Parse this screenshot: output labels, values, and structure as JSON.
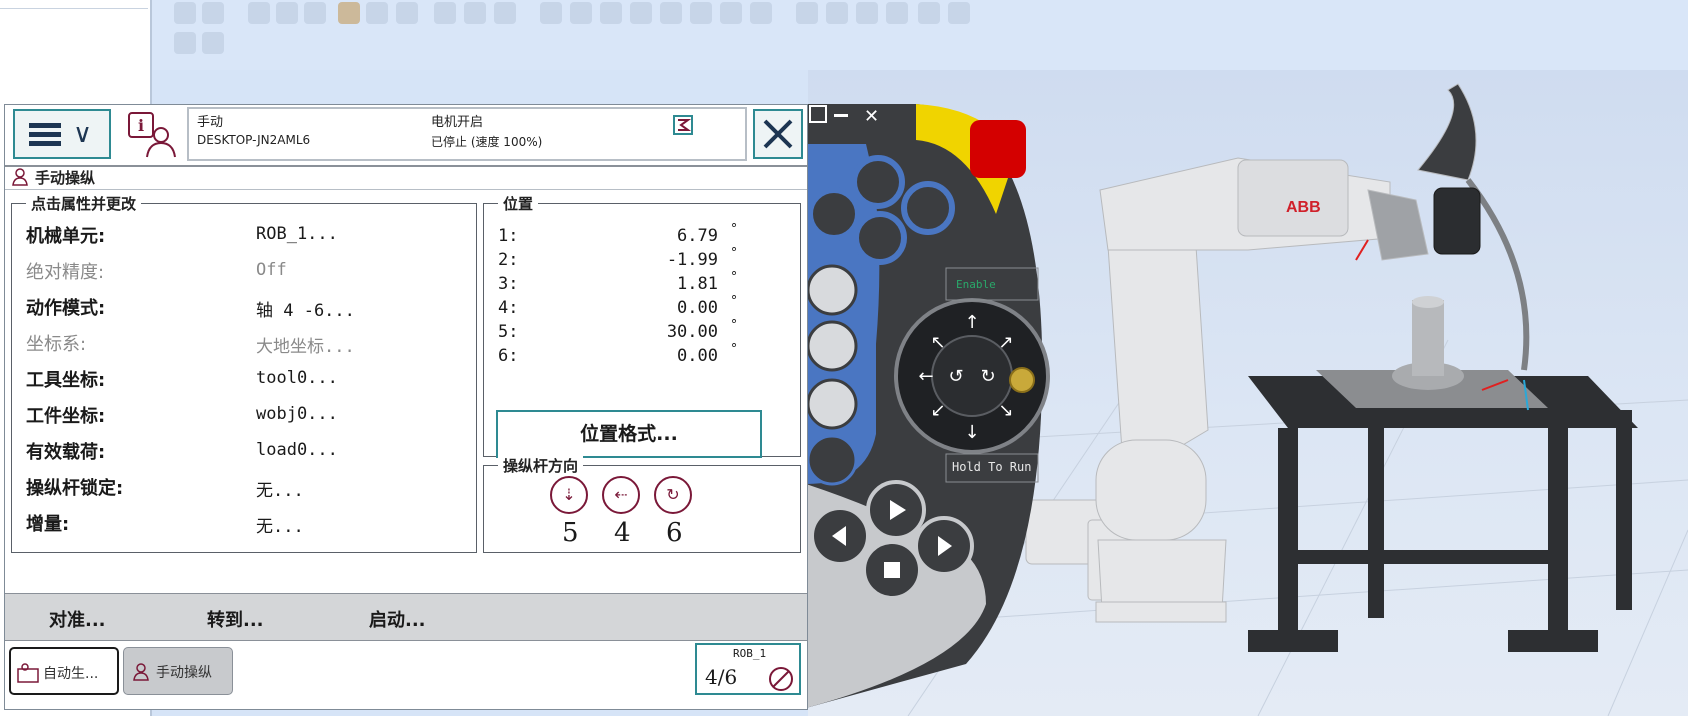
{
  "header": {
    "mode": "手动",
    "motor_state": "电机开启",
    "controller": "DESKTOP-JN2AML6",
    "run_state": "已停止 (速度 100%)"
  },
  "window_title": "手动操纵",
  "properties": {
    "legend": "点击属性并更改",
    "rows": [
      {
        "label": "机械单元:",
        "value": "ROB_1..."
      },
      {
        "label": "绝对精度:",
        "value": "Off"
      },
      {
        "label": "动作模式:",
        "value": "轴 4 -6..."
      },
      {
        "label": "坐标系:",
        "value": "大地坐标..."
      },
      {
        "label": "工具坐标:",
        "value": "tool0..."
      },
      {
        "label": "工件坐标:",
        "value": "wobj0..."
      },
      {
        "label": "有效载荷:",
        "value": "load0..."
      },
      {
        "label": "操纵杆锁定:",
        "value": "无..."
      },
      {
        "label": "增量:",
        "value": "无..."
      }
    ]
  },
  "position": {
    "legend": "位置",
    "rows": [
      {
        "axis": "1:",
        "value": "6.79",
        "unit": "°"
      },
      {
        "axis": "2:",
        "value": "-1.99",
        "unit": "°"
      },
      {
        "axis": "3:",
        "value": "1.81",
        "unit": "°"
      },
      {
        "axis": "4:",
        "value": "0.00",
        "unit": "°"
      },
      {
        "axis": "5:",
        "value": "30.00",
        "unit": "°"
      },
      {
        "axis": "6:",
        "value": "0.00",
        "unit": "°"
      }
    ],
    "format_button": "位置格式..."
  },
  "joystick": {
    "legend": "操纵杆方向",
    "axes": [
      "5",
      "4",
      "6"
    ]
  },
  "actions": {
    "align": "对准...",
    "goto": "转到...",
    "start": "启动..."
  },
  "taskbar": {
    "task1": "自动生...",
    "task2": "手动操纵",
    "unit": "ROB_1",
    "fraction": "4/6"
  },
  "pendant": {
    "enable": "Enable",
    "hold_to_run": "Hold To Run"
  },
  "robot_logo": "ABB",
  "colors": {
    "accent": "#2e8a92",
    "joystick_icon": "#7a1838",
    "pendant_yellow": "#f0d400",
    "estop_red": "#d40000",
    "pendant_blue": "#4a76c2"
  }
}
